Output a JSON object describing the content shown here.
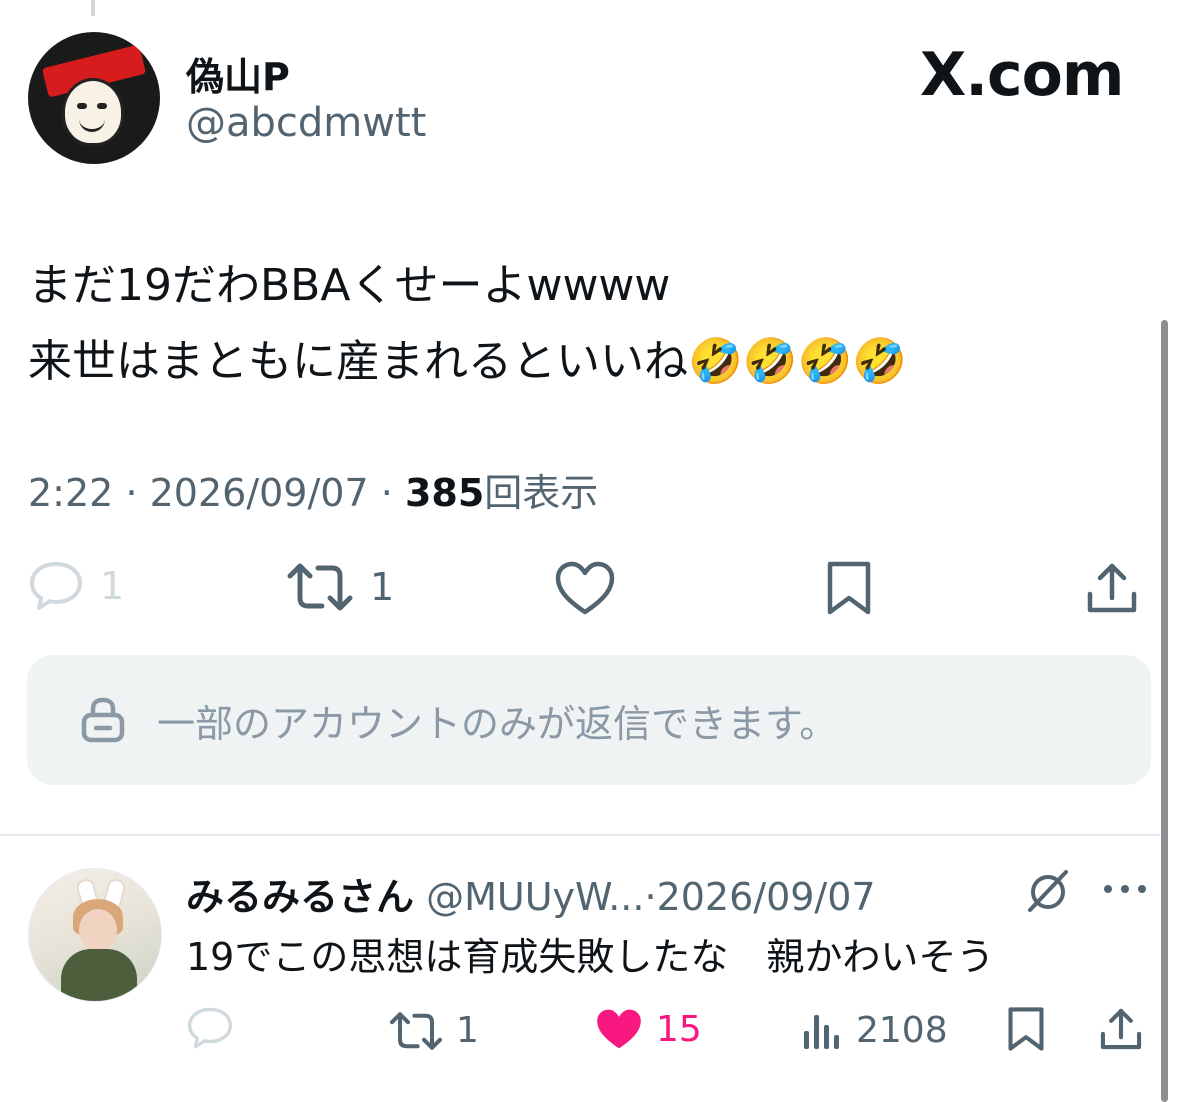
{
  "tweet": {
    "display_name": "偽山P",
    "handle": "@abcdmwtt",
    "brand": "X.com",
    "text_lines": [
      "まだ19だわBBAくせーよwwww",
      "来世はまともに産まれるといいね🤣🤣🤣🤣"
    ],
    "time": "2:22",
    "date": "2026/09/07",
    "views_count": "385",
    "views_label": "回表示",
    "sep": "·",
    "counts": {
      "replies": "1",
      "retweets": "1"
    },
    "reply_restriction": "一部のアカウントのみが返信できます。"
  },
  "reply": {
    "display_name": "みるみるさん",
    "handle": "@MUUyW...",
    "sep": "·",
    "date": "2026/09/07",
    "text": "19でこの思想は育成失敗したな　親かわいそう",
    "counts": {
      "retweets": "1",
      "likes": "15",
      "views": "2108"
    }
  },
  "colors": {
    "text": "#0f1419",
    "secondary": "#536471",
    "like": "#f91880",
    "panel": "#eff3f4"
  },
  "icons": [
    "reply-icon",
    "retweet-icon",
    "like-icon",
    "bookmark-icon",
    "share-icon",
    "lock-icon",
    "views-icon",
    "grok-icon",
    "more-icon"
  ]
}
